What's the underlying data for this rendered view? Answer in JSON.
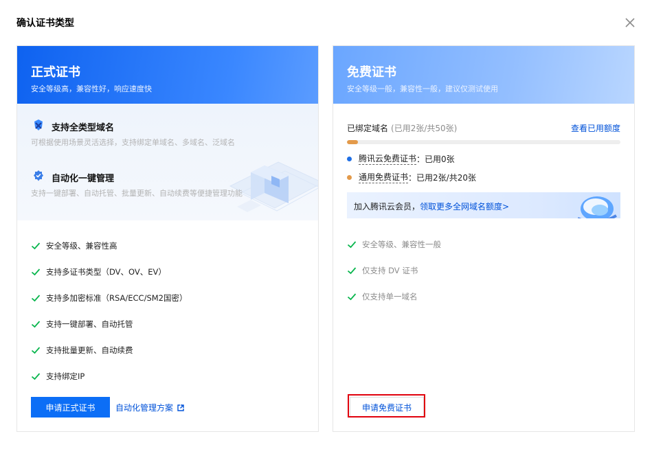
{
  "dialog": {
    "title": "确认证书类型"
  },
  "formal": {
    "title": "正式证书",
    "subtitle": "安全等级高，兼容性好，响应速度快",
    "features": [
      {
        "title": "支持全类型域名",
        "desc": "可根据使用场景灵活选择，支持绑定单域名、多域名、泛域名",
        "icon": "shield-star-icon"
      },
      {
        "title": "自动化一键管理",
        "desc": "支持一键部署、自动托管、批量更新、自动续费等便捷管理功能",
        "icon": "gear-badge-icon"
      }
    ],
    "checks": [
      "安全等级、兼容性高",
      "支持多证书类型（DV、OV、EV）",
      "支持多加密标准（RSA/ECC/SM2国密）",
      "支持一键部署、自动托管",
      "支持批量更新、自动续费",
      "支持绑定IP"
    ],
    "apply_button": "申请正式证书",
    "auto_link": "自动化管理方案"
  },
  "free": {
    "title": "免费证书",
    "subtitle": "安全等级一般，兼容性一般，建议仅测试使用",
    "bound_label": "已绑定域名",
    "bound_count": "(已用2张/共50张)",
    "bound_used": 2,
    "bound_total": 50,
    "view_link": "查看已用额度",
    "quotas": [
      {
        "name": "腾讯云免费证书",
        "value": "：已用0张",
        "color": "#1f6fe5"
      },
      {
        "name": "通用免费证书",
        "value": "：已用2张/共20张",
        "color": "#e39a4a"
      }
    ],
    "promo_text": "加入腾讯云会员，",
    "promo_link": "领取更多全网域名额度>",
    "checks": [
      "安全等级、兼容性一般",
      "仅支持 DV 证书",
      "仅支持单一域名"
    ],
    "apply_button": "申请免费证书"
  },
  "colors": {
    "primary": "#0c6ef6",
    "link": "#0052d9",
    "check": "#07b54c",
    "highlight": "#e0000c"
  }
}
